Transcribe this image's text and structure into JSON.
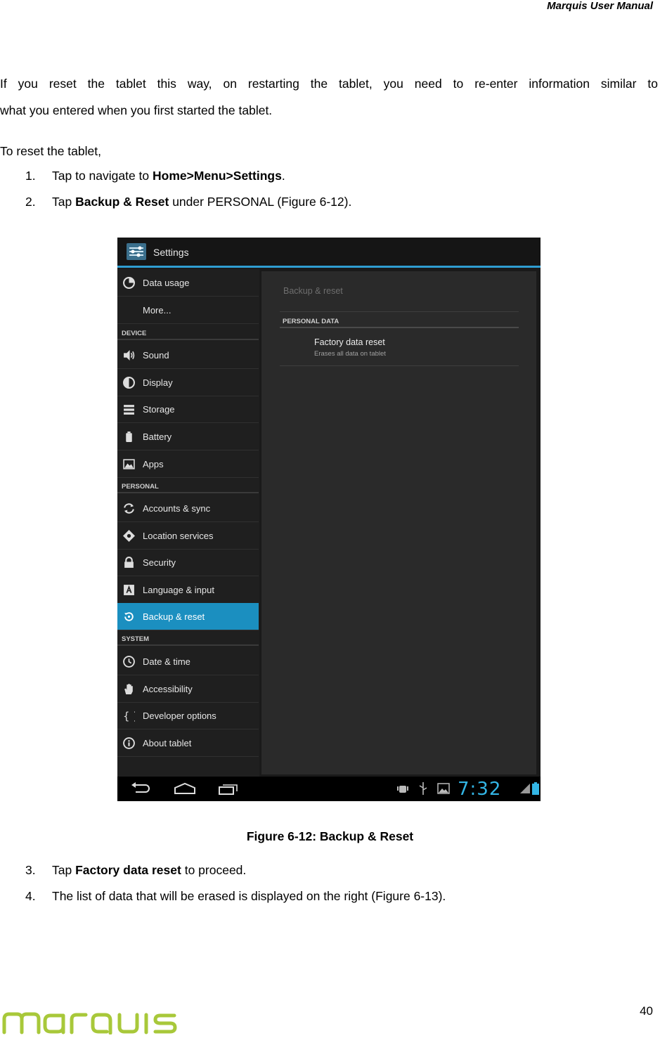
{
  "header": {
    "title": "Marquis User Manual"
  },
  "intro": {
    "line1": "If you reset the tablet this way, on restarting the tablet, you need to re-enter information similar to",
    "line2": "what you entered when you first started the tablet."
  },
  "to_reset": "To reset the tablet,",
  "steps_top": [
    {
      "num": "1.",
      "pre": "Tap to navigate to ",
      "bold": "Home>Menu>Settings",
      "post": "."
    },
    {
      "num": "2.",
      "pre": "Tap ",
      "bold": "Backup & Reset",
      "post": " under PERSONAL (Figure 6-12)."
    }
  ],
  "screenshot": {
    "app_title": "Settings",
    "menu": [
      {
        "label": "Data usage",
        "icon": "data-usage-icon"
      },
      {
        "label": "More...",
        "icon": ""
      },
      {
        "section": "DEVICE"
      },
      {
        "label": "Sound",
        "icon": "speaker-icon"
      },
      {
        "label": "Display",
        "icon": "brightness-icon"
      },
      {
        "label": "Storage",
        "icon": "storage-icon"
      },
      {
        "label": "Battery",
        "icon": "battery-icon"
      },
      {
        "label": "Apps",
        "icon": "apps-icon"
      },
      {
        "section": "PERSONAL"
      },
      {
        "label": "Accounts & sync",
        "icon": "sync-icon"
      },
      {
        "label": "Location services",
        "icon": "location-icon"
      },
      {
        "label": "Security",
        "icon": "lock-icon"
      },
      {
        "label": "Language & input",
        "icon": "keyboard-icon"
      },
      {
        "label": "Backup & reset",
        "icon": "backup-icon",
        "selected": true
      },
      {
        "section": "SYSTEM"
      },
      {
        "label": "Date & time",
        "icon": "clock-icon"
      },
      {
        "label": "Accessibility",
        "icon": "hand-icon"
      },
      {
        "label": "Developer options",
        "icon": "braces-icon"
      },
      {
        "label": "About tablet",
        "icon": "info-icon"
      }
    ],
    "panel": {
      "title": "Backup & reset",
      "section": "PERSONAL DATA",
      "item_title": "Factory data reset",
      "item_subtitle": "Erases all data on tablet"
    },
    "status": {
      "time": "7:32"
    },
    "accent_color": "#2f9dd1"
  },
  "caption": "Figure 6-12: Backup & Reset",
  "steps_bottom": [
    {
      "num": "3.",
      "pre": "Tap ",
      "bold": "Factory data reset",
      "post": " to proceed."
    },
    {
      "num": "4.",
      "pre": "The list of data that will be erased is displayed on the right (Figure 6-13).",
      "bold": "",
      "post": ""
    }
  ],
  "page_number": "40",
  "logo": {
    "text": "marquis",
    "color": "#a8c83a"
  }
}
